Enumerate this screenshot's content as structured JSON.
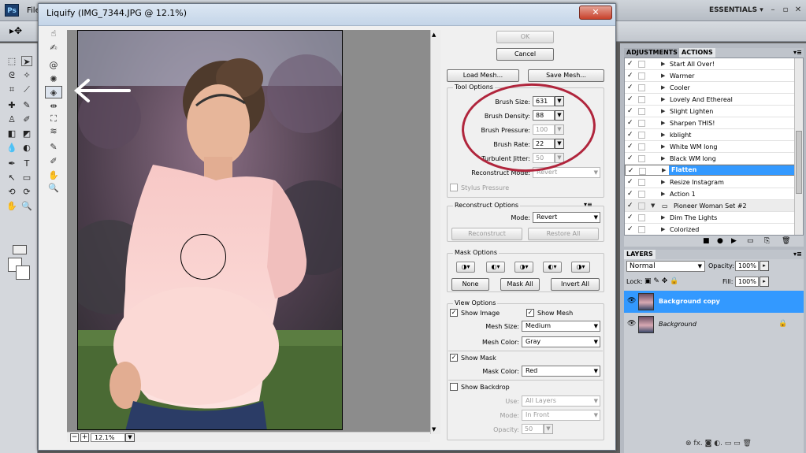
{
  "ps": {
    "logo": "Ps",
    "menu_partial": "File",
    "workspace": "ESSENTIALS ▾",
    "win_min": "–",
    "win_max": "▫",
    "win_close": "✕"
  },
  "actions_panel": {
    "tab_adjustments": "ADJUSTMENTS",
    "tab_actions": "ACTIONS",
    "items": [
      "Start All Over!",
      "Warmer",
      "Cooler",
      "Lovely And Ethereal",
      "Slight Lighten",
      "Sharpen THIS!",
      "kblight",
      "White WM long",
      "Black WM long",
      "Flatten",
      "Resize Instagram",
      "Action 1",
      "Pioneer Woman Set #2",
      "Dim The Lights",
      "Colorized"
    ],
    "selected": "Flatten",
    "set_name": "Pioneer Woman Set #2"
  },
  "layers_panel": {
    "tab": "LAYERS",
    "blend_mode": "Normal",
    "opacity_label": "Opacity:",
    "opacity_value": "100%",
    "lock_label": "Lock:",
    "fill_label": "Fill:",
    "fill_value": "100%",
    "layers": [
      "Background copy",
      "Background"
    ]
  },
  "liquify": {
    "title": "Liquify (IMG_7344.JPG @ 12.1%)",
    "close": "✕",
    "zoom": "12.1%",
    "zoom_minus": "−",
    "zoom_plus": "+",
    "ok": "OK",
    "cancel": "Cancel",
    "load_mesh": "Load Mesh...",
    "save_mesh": "Save Mesh...",
    "tool_options": {
      "title": "Tool Options",
      "brush_size_label": "Brush Size:",
      "brush_size": "631",
      "brush_density_label": "Brush Density:",
      "brush_density": "88",
      "brush_pressure_label": "Brush Pressure:",
      "brush_pressure": "100",
      "brush_rate_label": "Brush Rate:",
      "brush_rate": "22",
      "turbulent_jitter_label": "Turbulent Jitter:",
      "turbulent_jitter": "50",
      "reconstruct_mode_label": "Reconstruct Mode:",
      "reconstruct_mode": "Revert",
      "stylus_pressure": "Stylus Pressure"
    },
    "reconstruct_options": {
      "title": "Reconstruct Options",
      "mode_label": "Mode:",
      "mode": "Revert",
      "reconstruct": "Reconstruct",
      "restore_all": "Restore All"
    },
    "mask_options": {
      "title": "Mask Options",
      "none": "None",
      "mask_all": "Mask All",
      "invert_all": "Invert All"
    },
    "view_options": {
      "title": "View Options",
      "show_image": "Show Image",
      "show_mesh": "Show Mesh",
      "mesh_size_label": "Mesh Size:",
      "mesh_size": "Medium",
      "mesh_color_label": "Mesh Color:",
      "mesh_color": "Gray",
      "show_mask": "Show Mask",
      "mask_color_label": "Mask Color:",
      "mask_color": "Red",
      "show_backdrop": "Show Backdrop",
      "use_label": "Use:",
      "use": "All Layers",
      "mode_label": "Mode:",
      "mode": "In Front",
      "opacity_label": "Opacity:",
      "opacity": "50"
    }
  },
  "colors": {
    "annotation_red": "#b0253c",
    "selection_blue": "#3399ff"
  }
}
